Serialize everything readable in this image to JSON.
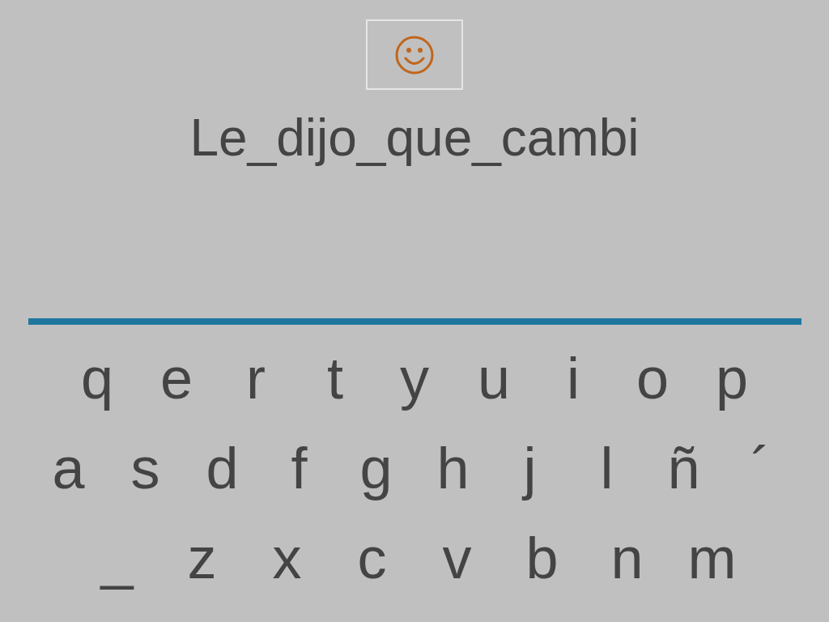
{
  "answer": "Le_dijo_que_cambi",
  "keyboard": [
    [
      "q",
      "e",
      "r",
      "t",
      "y",
      "u",
      "i",
      "o",
      "p"
    ],
    [
      "a",
      "s",
      "d",
      "f",
      "g",
      "h",
      "j",
      "l",
      "ñ",
      "´"
    ],
    [
      "_",
      "z",
      "x",
      "c",
      "v",
      "b",
      "n",
      "m"
    ]
  ]
}
